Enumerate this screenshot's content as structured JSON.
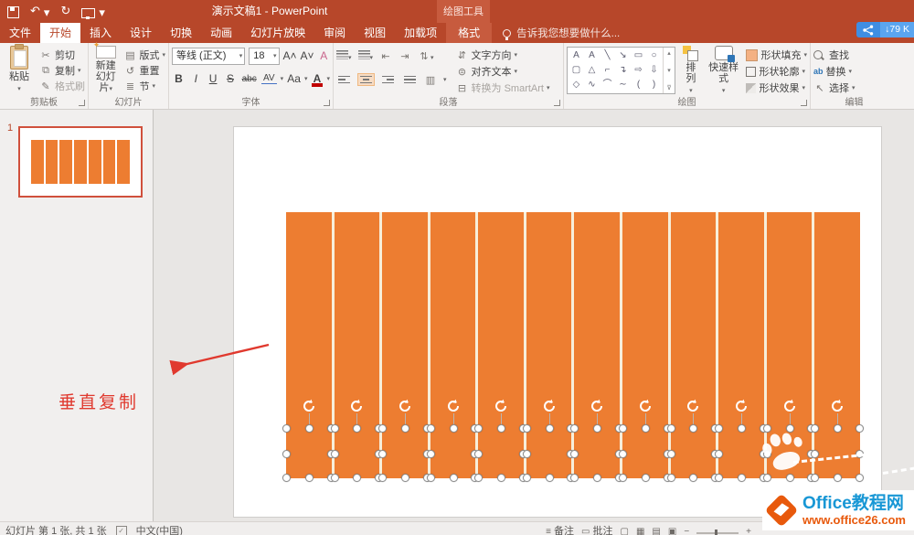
{
  "colors": {
    "accent_red": "#B7472A",
    "bar_orange": "#ED7D31",
    "annotation_red": "#E0392E",
    "logo_blue": "#1897D5",
    "logo_orange": "#E8590C",
    "badge_blue": "#5AA5F0"
  },
  "titlebar": {
    "title": "演示文稿1 - PowerPoint",
    "context_tool_label": "绘图工具",
    "net_badge_text": "↓79 K"
  },
  "qat": {
    "undo_glyph": "↶",
    "redo_glyph": "↻"
  },
  "tabs": {
    "items": [
      {
        "label": "文件",
        "name": "file"
      },
      {
        "label": "开始",
        "name": "home",
        "active": true
      },
      {
        "label": "插入",
        "name": "insert"
      },
      {
        "label": "设计",
        "name": "design"
      },
      {
        "label": "切换",
        "name": "transitions"
      },
      {
        "label": "动画",
        "name": "animations"
      },
      {
        "label": "幻灯片放映",
        "name": "slideshow"
      },
      {
        "label": "审阅",
        "name": "review"
      },
      {
        "label": "视图",
        "name": "view"
      },
      {
        "label": "加载项",
        "name": "addins"
      }
    ],
    "context_tab": "格式",
    "tellme": "告诉我您想要做什么..."
  },
  "ribbon": {
    "clipboard": {
      "group_label": "剪贴板",
      "paste": "粘贴",
      "cut": "剪切",
      "copy": "复制",
      "format_painter": "格式刷"
    },
    "slides": {
      "group_label": "幻灯片",
      "new_slide_l1": "新建",
      "new_slide_l2": "幻灯片",
      "layout": "版式",
      "reset": "重置",
      "section": "节"
    },
    "font": {
      "group_label": "字体",
      "name": "等线 (正文)",
      "size": "18",
      "buttons": {
        "bold": "B",
        "italic": "I",
        "underline": "U",
        "shadow": "S",
        "strike": "abc",
        "spacing": "AV",
        "case_btn": "Aa",
        "color": "A",
        "grow": "A˄",
        "shrink": "A˅",
        "clear": "A"
      }
    },
    "paragraph": {
      "group_label": "段落",
      "text_direction": "文字方向",
      "align_text": "对齐文本",
      "smartart": "转换为 SmartArt"
    },
    "drawing": {
      "group_label": "绘图",
      "arrange": "排列",
      "quick_styles": "快速样式",
      "shape_fill": "形状填充",
      "shape_outline": "形状轮廓",
      "shape_effects": "形状效果"
    },
    "editing": {
      "group_label": "编辑",
      "find": "查找",
      "replace": "替换",
      "select": "选择"
    }
  },
  "shape_gallery": [
    {
      "name": "horizontal-text-box",
      "glyph": "A"
    },
    {
      "name": "vertical-text-box",
      "glyph": "A"
    },
    {
      "name": "line",
      "glyph": "╲"
    },
    {
      "name": "arrow",
      "glyph": "↘"
    },
    {
      "name": "rectangle",
      "glyph": "▭"
    },
    {
      "name": "oval",
      "glyph": "○"
    },
    {
      "name": "rounded-rectangle",
      "glyph": "▢"
    },
    {
      "name": "triangle",
      "glyph": "△"
    },
    {
      "name": "elbow-connector",
      "glyph": "⌐"
    },
    {
      "name": "elbow-arrow-connector",
      "glyph": "↴"
    },
    {
      "name": "right-arrow",
      "glyph": "⇨"
    },
    {
      "name": "down-arrow",
      "glyph": "⇩"
    },
    {
      "name": "freeform",
      "glyph": "◇"
    },
    {
      "name": "scribble",
      "glyph": "∿"
    },
    {
      "name": "arc",
      "glyph": "⌒"
    },
    {
      "name": "curve",
      "glyph": "∼"
    },
    {
      "name": "left-bracket",
      "glyph": "("
    },
    {
      "name": "right-bracket",
      "glyph": ")"
    }
  ],
  "thumb_panel": {
    "slide_number": "1",
    "bars": [
      1,
      2,
      3,
      4,
      5,
      6,
      7
    ]
  },
  "slide": {
    "bars": [
      1,
      2,
      3,
      4,
      5,
      6,
      7,
      8,
      9,
      10,
      11,
      12
    ]
  },
  "annotation": {
    "text": "垂直复制"
  },
  "watermark": {
    "site_name": "Office教程网",
    "site_url": "www.office26.com"
  },
  "statusbar": {
    "slide_info": "幻灯片 第 1 张, 共 1 张",
    "language": "中文(中国)",
    "notes": "备注",
    "comments": "批注"
  }
}
